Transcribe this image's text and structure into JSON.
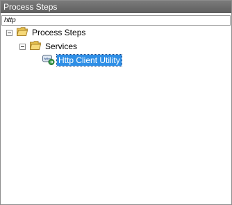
{
  "panel": {
    "title": "Process Steps"
  },
  "search": {
    "value": "http",
    "placeholder": ""
  },
  "tree": {
    "root": {
      "label": "Process Steps"
    },
    "child": {
      "label": "Services"
    },
    "leaf": {
      "label": "Http Client Utility",
      "selected": true
    }
  },
  "colors": {
    "title_bar": "#6b6b6b",
    "selection": "#2f8fe6",
    "folder": "#e7c14f"
  },
  "icons": {
    "collapse": "minus-box-icon",
    "folder": "folder-open-icon",
    "service": "http-service-icon"
  }
}
